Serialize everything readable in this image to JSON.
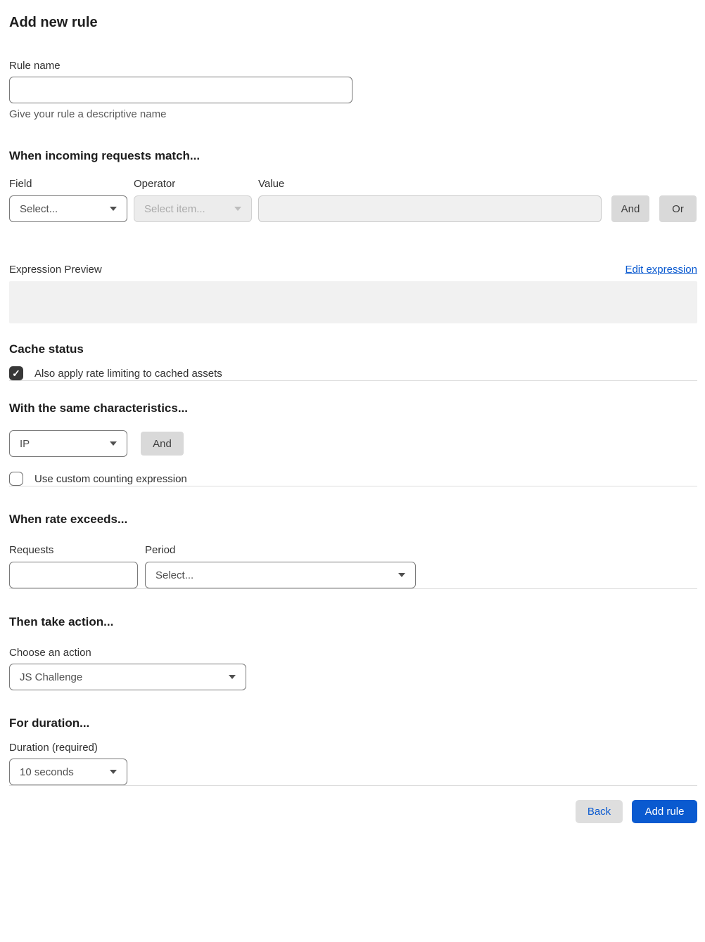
{
  "page": {
    "title": "Add new rule"
  },
  "colors": {
    "accent_blue": "#0a5ad0",
    "checkbox_checked": "#383838",
    "disabled_bg": "#ececec",
    "preview_bg": "#f1f1f1",
    "gray_button_bg": "#d9d9d9"
  },
  "icons": {
    "check": "✓",
    "chevron_down": "caret-triangle"
  },
  "rule_name": {
    "label": "Rule name",
    "value": "",
    "helper": "Give your rule a descriptive name"
  },
  "match": {
    "heading": "When incoming requests match...",
    "field": {
      "label": "Field",
      "selected": "Select...",
      "disabled": false
    },
    "operator": {
      "label": "Operator",
      "selected": "Select item...",
      "disabled": true
    },
    "value": {
      "label": "Value",
      "value": "",
      "disabled": true
    },
    "and_label": "And",
    "or_label": "Or"
  },
  "expression": {
    "label": "Expression Preview",
    "edit_link": "Edit expression",
    "preview": ""
  },
  "cache": {
    "heading": "Cache status",
    "checkbox_label": "Also apply rate limiting to cached assets",
    "checked": true
  },
  "characteristics": {
    "heading": "With the same characteristics...",
    "selected": "IP",
    "and_label": "And",
    "counting_label": "Use custom counting expression",
    "counting_checked": false
  },
  "rate": {
    "heading": "When rate exceeds...",
    "requests_label": "Requests",
    "requests_value": "",
    "period_label": "Period",
    "period_selected": "Select..."
  },
  "action": {
    "heading": "Then take action...",
    "label": "Choose an action",
    "selected": "JS Challenge"
  },
  "duration": {
    "heading": "For duration...",
    "label": "Duration (required)",
    "selected": "10 seconds"
  },
  "footer": {
    "back_label": "Back",
    "add_label": "Add rule"
  }
}
